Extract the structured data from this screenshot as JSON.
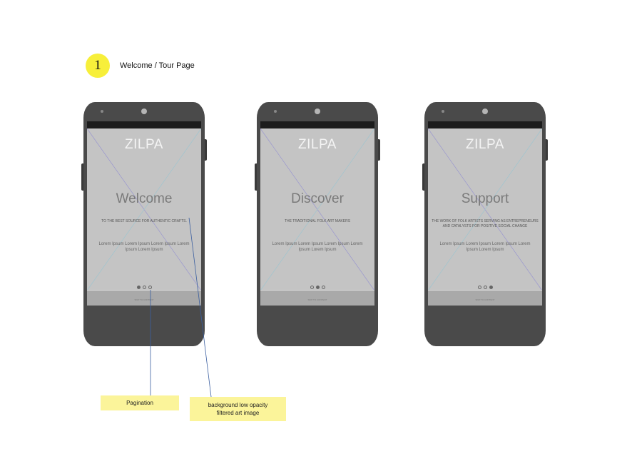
{
  "header": {
    "step_number": "1",
    "title": "Welcome / Tour Page"
  },
  "screens": [
    {
      "brand": "ZILPA",
      "heading": "Welcome",
      "tagline": "TO THE BEST SOURCE FOR AUTHENTIC CRAFTS.",
      "lorem": "Lorem Ipsum Lorem Ipsum Lorem Ipsum Lorem Ipsum Lorem Ipsum",
      "active_dot": 0,
      "skip": "SKIP TO CONTENT"
    },
    {
      "brand": "ZILPA",
      "heading": "Discover",
      "tagline": "THE TRADITIONAL FOLK ART MAKERS",
      "lorem": "Lorem Ipsum Lorem Ipsum Lorem Ipsum Lorem Ipsum Lorem Ipsum",
      "active_dot": 1,
      "skip": "SKIP TO CONTENT"
    },
    {
      "brand": "ZILPA",
      "heading": "Support",
      "tagline": "THE WORK OF FOLK ARTISTS SERVING AS ENTREPRENEURS AND CATALYSTS FOR POSITIVE SOCIAL CHANGE",
      "lorem": "Lorem Ipsum Lorem Ipsum Lorem Ipsum Lorem Ipsum Lorem Ipsum",
      "active_dot": 2,
      "skip": "SKIP TO CONTENT"
    }
  ],
  "annotations": {
    "pagination": "Pagination",
    "background_line1": "background  low opacity",
    "background_line2": "filtered art image"
  },
  "colors": {
    "highlight": "#f7ef3a",
    "note_fill": "#fbf49a",
    "phone_body": "#4a4a4a",
    "screen_fill": "#c4c4c4",
    "callout_line": "#3b5fa0"
  },
  "icons": [
    "front-camera-icon",
    "proximity-sensor-icon",
    "pagination-dot-icon"
  ]
}
